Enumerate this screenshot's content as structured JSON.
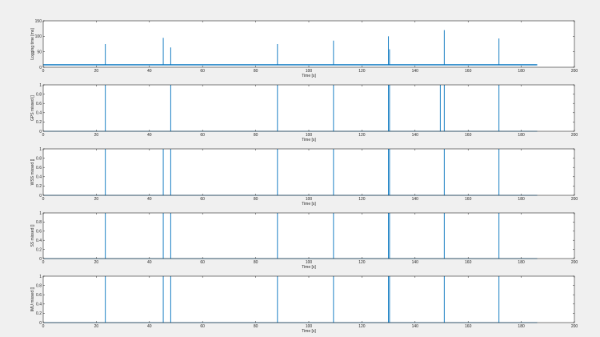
{
  "chart_data": [
    {
      "type": "line",
      "title": "",
      "xlabel": "Time [s]",
      "ylabel": "Logging time [ms]",
      "xlim": [
        0,
        200
      ],
      "ylim": [
        0,
        150
      ],
      "xticks": [
        0,
        20,
        40,
        60,
        80,
        100,
        120,
        140,
        160,
        180,
        200
      ],
      "yticks": [
        0,
        50,
        100,
        150
      ],
      "grid": false,
      "color": "#0072bd",
      "baseline": 8,
      "x_end": 186,
      "spikes": [
        {
          "x": 23.4,
          "y": 75
        },
        {
          "x": 45.2,
          "y": 95
        },
        {
          "x": 48.0,
          "y": 64
        },
        {
          "x": 88.2,
          "y": 75
        },
        {
          "x": 109.3,
          "y": 86
        },
        {
          "x": 130.0,
          "y": 100
        },
        {
          "x": 130.4,
          "y": 58
        },
        {
          "x": 151.0,
          "y": 120
        },
        {
          "x": 171.6,
          "y": 93
        }
      ]
    },
    {
      "type": "line",
      "title": "",
      "xlabel": "Time [s]",
      "ylabel": "GPS missed []",
      "xlim": [
        0,
        200
      ],
      "ylim": [
        0,
        1
      ],
      "xticks": [
        0,
        20,
        40,
        60,
        80,
        100,
        120,
        140,
        160,
        180,
        200
      ],
      "yticks": [
        0,
        0.2,
        0.4,
        0.6,
        0.8,
        1
      ],
      "grid": false,
      "color": "#0072bd",
      "x_end": 186,
      "spikes": [
        {
          "x": 23.4,
          "y": 1
        },
        {
          "x": 48.0,
          "y": 1
        },
        {
          "x": 88.2,
          "y": 1
        },
        {
          "x": 109.3,
          "y": 1
        },
        {
          "x": 130.0,
          "y": 1
        },
        {
          "x": 130.4,
          "y": 1
        },
        {
          "x": 149.5,
          "y": 1
        },
        {
          "x": 151.0,
          "y": 1
        },
        {
          "x": 171.6,
          "y": 1
        }
      ]
    },
    {
      "type": "line",
      "title": "",
      "xlabel": "Time [s]",
      "ylabel": "WSS missed []",
      "xlim": [
        0,
        200
      ],
      "ylim": [
        0,
        1
      ],
      "xticks": [
        0,
        20,
        40,
        60,
        80,
        100,
        120,
        140,
        160,
        180,
        200
      ],
      "yticks": [
        0,
        0.2,
        0.4,
        0.6,
        0.8,
        1
      ],
      "grid": false,
      "color": "#0072bd",
      "x_end": 186,
      "spikes": [
        {
          "x": 23.4,
          "y": 1
        },
        {
          "x": 45.2,
          "y": 1
        },
        {
          "x": 48.0,
          "y": 1
        },
        {
          "x": 88.2,
          "y": 1
        },
        {
          "x": 109.3,
          "y": 1
        },
        {
          "x": 130.0,
          "y": 1
        },
        {
          "x": 130.4,
          "y": 1
        },
        {
          "x": 151.0,
          "y": 1
        },
        {
          "x": 171.6,
          "y": 1
        }
      ]
    },
    {
      "type": "line",
      "title": "",
      "xlabel": "Time [s]",
      "ylabel": "SS missed []",
      "xlim": [
        0,
        200
      ],
      "ylim": [
        0,
        1
      ],
      "xticks": [
        0,
        20,
        40,
        60,
        80,
        100,
        120,
        140,
        160,
        180,
        200
      ],
      "yticks": [
        0,
        0.2,
        0.4,
        0.6,
        0.8,
        1
      ],
      "grid": false,
      "color": "#0072bd",
      "x_end": 186,
      "spikes": [
        {
          "x": 23.4,
          "y": 1
        },
        {
          "x": 45.2,
          "y": 1
        },
        {
          "x": 48.0,
          "y": 1
        },
        {
          "x": 88.2,
          "y": 1
        },
        {
          "x": 109.3,
          "y": 1
        },
        {
          "x": 130.0,
          "y": 1
        },
        {
          "x": 130.4,
          "y": 1
        },
        {
          "x": 151.0,
          "y": 1
        },
        {
          "x": 171.6,
          "y": 1
        }
      ]
    },
    {
      "type": "line",
      "title": "",
      "xlabel": "Time [s]",
      "ylabel": "IMU missed []",
      "xlim": [
        0,
        200
      ],
      "ylim": [
        0,
        1
      ],
      "xticks": [
        0,
        20,
        40,
        60,
        80,
        100,
        120,
        140,
        160,
        180,
        200
      ],
      "yticks": [
        0,
        0.2,
        0.4,
        0.6,
        0.8,
        1
      ],
      "grid": false,
      "color": "#0072bd",
      "x_end": 186,
      "spikes": [
        {
          "x": 23.4,
          "y": 1
        },
        {
          "x": 45.2,
          "y": 1
        },
        {
          "x": 48.0,
          "y": 1
        },
        {
          "x": 88.2,
          "y": 1
        },
        {
          "x": 109.3,
          "y": 1
        },
        {
          "x": 130.0,
          "y": 1
        },
        {
          "x": 130.4,
          "y": 1
        },
        {
          "x": 151.0,
          "y": 1
        },
        {
          "x": 171.6,
          "y": 1
        }
      ]
    }
  ]
}
